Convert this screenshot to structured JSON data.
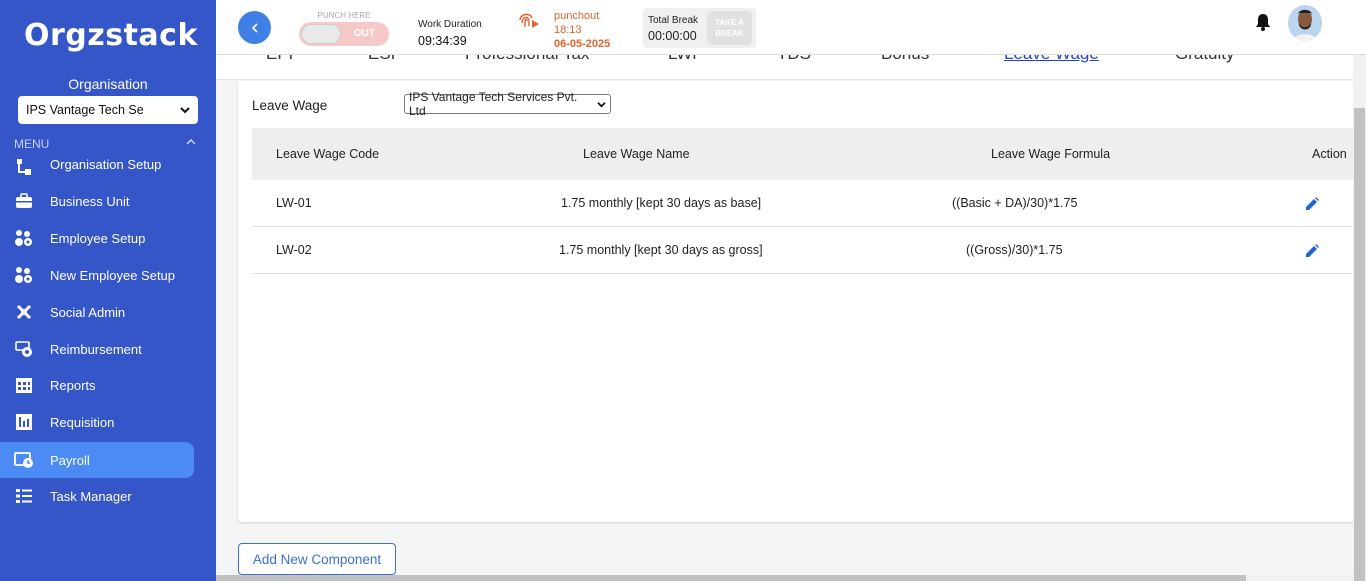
{
  "app": {
    "logo": "Orgzstack",
    "org_label": "Organisation",
    "org_selected": "IPS Vantage Tech Se",
    "menu_label": "MENU"
  },
  "sidebar": {
    "items": [
      {
        "label": "Organisation Setup",
        "icon": "hierarchy-icon"
      },
      {
        "label": "Business Unit",
        "icon": "briefcase-icon"
      },
      {
        "label": "Employee Setup",
        "icon": "users-gear-icon"
      },
      {
        "label": "New Employee Setup",
        "icon": "users-gear-icon"
      },
      {
        "label": "Social Admin",
        "icon": "joomla-icon"
      },
      {
        "label": "Reimbursement",
        "icon": "money-refresh-icon"
      },
      {
        "label": "Reports",
        "icon": "calendar-grid-icon"
      },
      {
        "label": "Requisition",
        "icon": "chart-bars-icon"
      },
      {
        "label": "Payroll",
        "icon": "payroll-icon"
      },
      {
        "label": "Task Manager",
        "icon": "task-list-icon"
      }
    ],
    "active_index": 8
  },
  "topbar": {
    "punch_caption": "PUNCH HERE",
    "punch_state": "OUT",
    "work_duration_label": "Work Duration",
    "work_duration_value": "09:34:39",
    "punchout_label": "punchout",
    "punchout_time": "18:13",
    "punchout_date": "06-05-2025",
    "total_break_label": "Total Break",
    "total_break_value": "00:00:00",
    "take_break_label": "TAKE A BREAK",
    "colors": {
      "accent": "#3556c8",
      "punchout": "#e0642a"
    }
  },
  "tabs": [
    {
      "label": "EPF"
    },
    {
      "label": "ESI"
    },
    {
      "label": "Professional Tax"
    },
    {
      "label": "LWF"
    },
    {
      "label": "TDS"
    },
    {
      "label": "Bonus"
    },
    {
      "label": "Leave Wage",
      "active": true
    },
    {
      "label": "Gratuity"
    }
  ],
  "leave_wage": {
    "label": "Leave Wage",
    "company_selected": "IPS Vantage Tech Services Pvt. Ltd",
    "columns": [
      "Leave Wage Code",
      "Leave Wage Name",
      "Leave Wage Formula",
      "Action"
    ],
    "rows": [
      {
        "code": "LW-01",
        "name": "1.75 monthly [kept 30 days as base]",
        "formula": "((Basic + DA)/30)*1.75"
      },
      {
        "code": "LW-02",
        "name": "1.75 monthly [kept 30 days as gross]",
        "formula": "((Gross)/30)*1.75"
      }
    ]
  },
  "actions": {
    "add_component": "Add New Component"
  }
}
